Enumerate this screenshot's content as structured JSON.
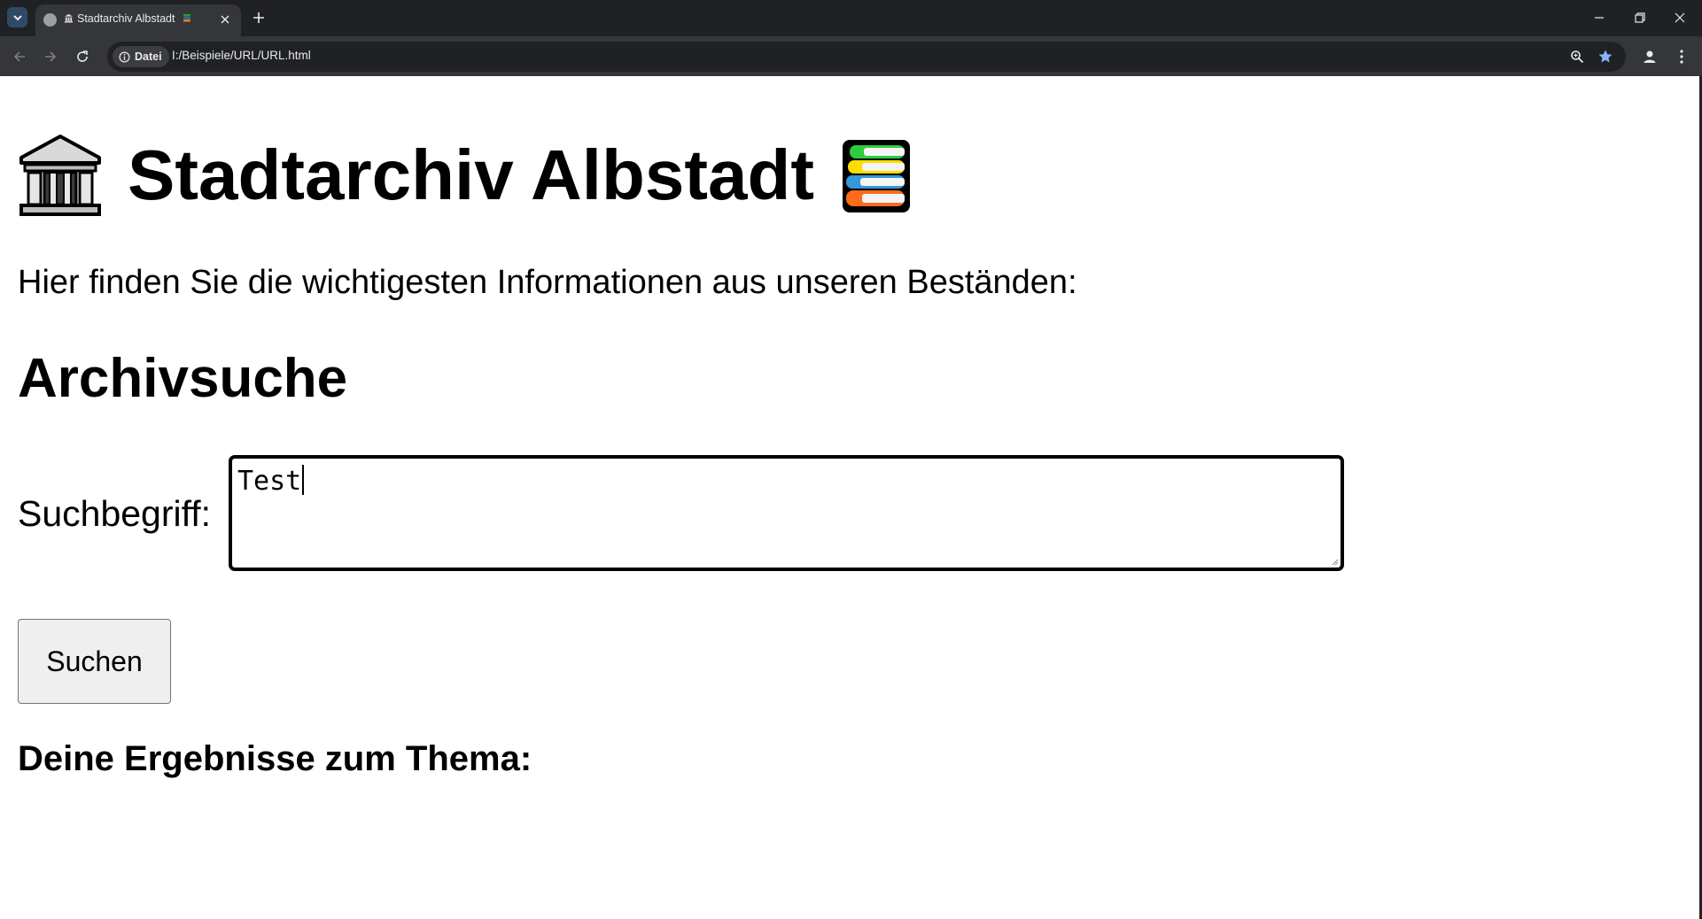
{
  "browser": {
    "tab_title": "Stadtarchiv Albstadt",
    "omnibox": {
      "security_chip": "Datei",
      "url": "I:/Beispiele/URL/URL.html"
    },
    "icons": {
      "tab_search": "chevron-down-icon",
      "favicon": "globe-icon",
      "close": "close-icon",
      "new_tab": "plus-icon",
      "back": "arrow-left-icon",
      "forward": "arrow-right-icon",
      "reload": "reload-icon",
      "zoom": "zoom-icon",
      "bookmark": "star-icon",
      "profile": "person-icon",
      "menu": "kebab-icon"
    },
    "colors": {
      "chrome_dark": "#202124",
      "toolbar": "#35363a",
      "bookmark_star": "#8ab4f8"
    }
  },
  "page": {
    "title": "Stadtarchiv Albstadt",
    "title_icons": [
      "classical-building-icon",
      "books-icon"
    ],
    "intro": "Hier finden Sie die wichtigesten Informationen aus unseren Beständen:",
    "search_section": {
      "heading": "Archivsuche",
      "label": "Suchbegriff:",
      "input_value": "Test",
      "button_label": "Suchen"
    },
    "results_heading": "Deine Ergebnisse zum Thema:"
  }
}
